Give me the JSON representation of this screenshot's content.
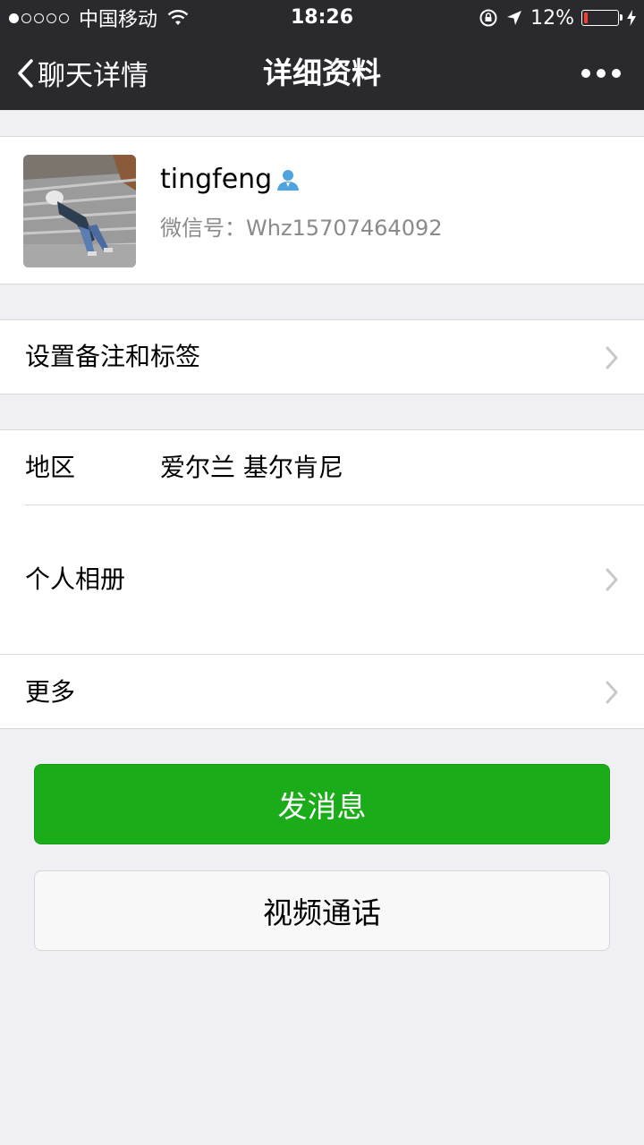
{
  "status_bar": {
    "carrier": "中国移动",
    "time": "18:26",
    "battery_percent": "12%",
    "battery_level": 0.12,
    "signal_dots_filled": 1,
    "signal_dots_total": 5
  },
  "nav": {
    "back_label": "聊天详情",
    "title": "详细资料"
  },
  "profile": {
    "name": "tingfeng",
    "wechat_id": "微信号：Whz15707464092"
  },
  "cells": {
    "remark_label": "设置备注和标签",
    "region_label": "地区",
    "region_value": "爱尔兰 基尔肯尼",
    "album_label": "个人相册",
    "more_label": "更多"
  },
  "buttons": {
    "send_message": "发消息",
    "video_call": "视频通话"
  },
  "colors": {
    "bar_bg": "#2a2a2e",
    "green": "#1aad19",
    "page_bg": "#efeff4"
  }
}
